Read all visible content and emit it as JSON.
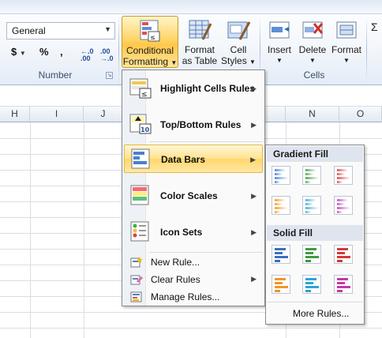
{
  "ribbon": {
    "number_format": {
      "value": "General"
    },
    "number_group": {
      "label": "Number",
      "currency": "$",
      "percent": "%",
      "comma": ",",
      "inc_decimal": "←.0 .00",
      "dec_decimal": ".00 →.0"
    },
    "buttons": {
      "conditional_formatting": {
        "line1": "Conditional",
        "line2": "Formatting"
      },
      "format_as_table": {
        "line1": "Format",
        "line2": "as Table"
      },
      "cell_styles": {
        "line1": "Cell",
        "line2": "Styles"
      },
      "insert": {
        "line1": "Insert"
      },
      "delete": {
        "line1": "Delete"
      },
      "format": {
        "line1": "Format"
      }
    },
    "cells_group": {
      "label": "Cells"
    }
  },
  "sheet": {
    "columns": [
      "H",
      "I",
      "J",
      "N",
      "O"
    ]
  },
  "menu": {
    "items": [
      {
        "label": "Highlight Cells Rules",
        "has_submenu": true
      },
      {
        "label": "Top/Bottom Rules",
        "has_submenu": true
      },
      {
        "label": "Data Bars",
        "has_submenu": true,
        "highlighted": true
      },
      {
        "label": "Color Scales",
        "has_submenu": true
      },
      {
        "label": "Icon Sets",
        "has_submenu": true
      }
    ],
    "small_items": [
      {
        "label": "New Rule...",
        "has_submenu": false
      },
      {
        "label": "Clear Rules",
        "has_submenu": true
      },
      {
        "label": "Manage Rules...",
        "has_submenu": false
      }
    ]
  },
  "submenu": {
    "gradient_fill": {
      "label": "Gradient Fill",
      "colors": [
        "#5b8fd6",
        "#5aab5a",
        "#e05a5a",
        "#f3a43a",
        "#58b4d8",
        "#c25fc2"
      ]
    },
    "solid_fill": {
      "label": "Solid Fill",
      "colors": [
        "#3a6fc0",
        "#3f9a3f",
        "#d23a3a",
        "#f0962a",
        "#2ea3d4",
        "#c23aa6"
      ]
    },
    "more_rules": "More Rules..."
  }
}
